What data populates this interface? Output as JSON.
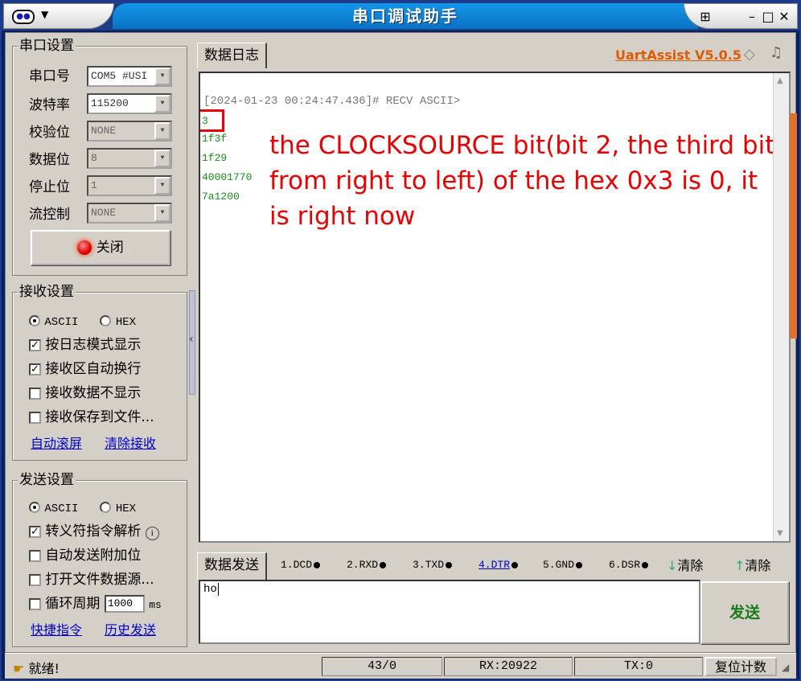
{
  "window": {
    "title": "串口调试助手",
    "brand": "UartAssist V5.0.5"
  },
  "serial": {
    "group_title": "串口设置",
    "port_label": "串口号",
    "port_value": "COM5 #USI",
    "baud_label": "波特率",
    "baud_value": "115200",
    "parity_label": "校验位",
    "parity_value": "NONE",
    "data_label": "数据位",
    "data_value": "8",
    "stop_label": "停止位",
    "stop_value": "1",
    "flow_label": "流控制",
    "flow_value": "NONE",
    "close_button": "关闭"
  },
  "receive": {
    "group_title": "接收设置",
    "radio_ascii": "ASCII",
    "radio_hex": "HEX",
    "opt_log_mode": "按日志模式显示",
    "opt_auto_wrap": "接收区自动换行",
    "opt_hide_data": "接收数据不显示",
    "opt_save_file": "接收保存到文件...",
    "link_autoscroll": "自动滚屏",
    "link_clear": "清除接收"
  },
  "send": {
    "group_title": "发送设置",
    "radio_ascii": "ASCII",
    "radio_hex": "HEX",
    "opt_escape": "转义符指令解析",
    "opt_append": "自动发送附加位",
    "opt_open_file": "打开文件数据源...",
    "opt_cycle": "循环周期",
    "cycle_value": "1000",
    "cycle_unit": "ms",
    "link_shortcut": "快捷指令",
    "link_history": "历史发送"
  },
  "log": {
    "tab_label": "数据日志",
    "header": "[2024-01-23 00:24:47.436]# RECV ASCII>",
    "lines": [
      "3",
      "1f3f",
      "1f29",
      "40001770",
      "7a1200"
    ],
    "annotation": "the CLOCKSOURCE bit(bit 2, the third bit from right to left) of the hex 0x3 is 0, it is right now"
  },
  "sendpanel": {
    "tab_label": "数据发送",
    "signals": [
      "1.DCD",
      "2.RXD",
      "3.TXD",
      "4.DTR",
      "5.GND",
      "6.DSR"
    ],
    "clear1": "清除",
    "clear2": "清除",
    "input_value": "ho",
    "send_button": "发送"
  },
  "status": {
    "ready": "就绪!",
    "counter": "43/0",
    "rx": "RX:20922",
    "tx": "TX:0",
    "reset": "复位计数"
  },
  "colors": {
    "accent": "#0a72c4",
    "green_text": "#1a8a1a",
    "annotation_red": "#e60000",
    "brand_orange": "#e05a00"
  }
}
